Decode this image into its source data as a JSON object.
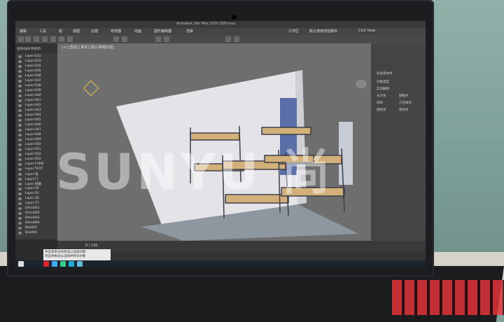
{
  "app": {
    "title": "Autodesk 3ds Max 2016    SSN.max",
    "window_tabs": [
      "工作区",
      "默认使用增强菜单",
      "Civil View"
    ]
  },
  "menus": [
    "编辑",
    "工具",
    "组",
    "视图",
    "创建",
    "修改器",
    "动画",
    "图形编辑器",
    "渲染"
  ],
  "scene_explorer": {
    "header": "名称(按升序排序)",
    "layers": [
      "Layer:032",
      "Layer:033",
      "Layer:034",
      "Layer:035",
      "Layer:036",
      "Layer:037",
      "Layer:038",
      "Layer:039",
      "Layer:040",
      "Layer:041",
      "Layer:042",
      "Layer:043",
      "Layer:044",
      "Layer:045",
      "Layer:046",
      "Layer:047",
      "Layer:048",
      "Layer:049",
      "Layer:050",
      "Layer:051",
      "Layer:052",
      "Layer:053",
      "Layer:FURN",
      "Layer:TEXT",
      "Layer:墙",
      "Layer:门",
      "Layer:地面",
      "Layer:54",
      "Layer:55",
      "Layer:56",
      "Layer:57",
      "Omni001",
      "Omni002",
      "Omni003",
      "Omni004",
      "Box002",
      "Box004"
    ]
  },
  "viewport": {
    "label": "[+] [透视] [真实] [默认明暗处理]"
  },
  "command_panel": {
    "items": [
      "标准基本体",
      "对象类型",
      "自动栅格",
      "长方体",
      "圆锥体",
      "球体",
      "几何球体",
      "圆柱体",
      "管状体"
    ]
  },
  "timeline": {
    "frame": "0 / 100"
  },
  "status": {
    "notice_line1": "单击或单击并拖动以选择对象",
    "notice_line2": "单击并拖动以选择并移动对象"
  },
  "watermark": "SUNYU 尚",
  "colors": {
    "screen_bg": "#2b2b2b",
    "viewport_bg": "#6e6e6e",
    "keyboard_red": "#e0343a"
  }
}
